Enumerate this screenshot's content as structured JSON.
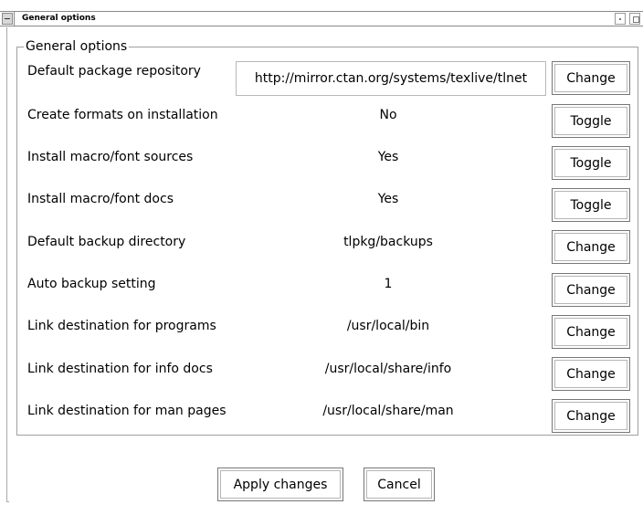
{
  "window": {
    "title": "General options"
  },
  "group": {
    "label": "General options"
  },
  "rows": [
    {
      "label": "Default package repository",
      "value": "http://mirror.ctan.org/systems/texlive/tlnet",
      "button": "Change"
    },
    {
      "label": "Create formats on installation",
      "value": "No",
      "button": "Toggle"
    },
    {
      "label": "Install macro/font sources",
      "value": "Yes",
      "button": "Toggle"
    },
    {
      "label": "Install macro/font docs",
      "value": "Yes",
      "button": "Toggle"
    },
    {
      "label": "Default backup directory",
      "value": "tlpkg/backups",
      "button": "Change"
    },
    {
      "label": "Auto backup setting",
      "value": "1",
      "button": "Change"
    },
    {
      "label": "Link destination for programs",
      "value": "/usr/local/bin",
      "button": "Change"
    },
    {
      "label": "Link destination for info docs",
      "value": "/usr/local/share/info",
      "button": "Change"
    },
    {
      "label": "Link destination for man pages",
      "value": "/usr/local/share/man",
      "button": "Change"
    }
  ],
  "footer": {
    "apply_label": "Apply changes",
    "cancel_label": "Cancel"
  }
}
